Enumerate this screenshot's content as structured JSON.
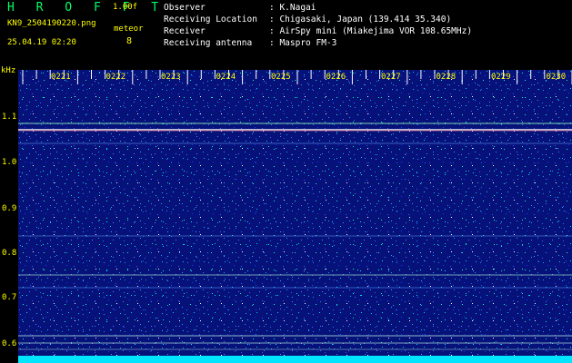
{
  "header": {
    "app_title": "H R O F F T",
    "version": "1.00f",
    "filename": "KN9_2504190220.png",
    "meteor_label": "meteor",
    "meteor_count": "8",
    "datetime": "25.04.19 02:20"
  },
  "info": [
    {
      "key": "Observer",
      "value": ": K.Nagai"
    },
    {
      "key": "Receiving Location",
      "value": ": Chigasaki, Japan (139.414 35.340)"
    },
    {
      "key": "Receiver",
      "value": ": AirSpy mini (Miakejima VOR 108.65MHz)"
    },
    {
      "key": "Receiving antenna",
      "value": ": Maspro FM-3"
    }
  ],
  "axis": {
    "unit": "kHz",
    "y_labels": [
      "1.1",
      "1.0",
      "0.9",
      "0.8",
      "0.7",
      "0.6"
    ],
    "time_labels": [
      "0221",
      "0222",
      "0223",
      "0224",
      "0225",
      "0226",
      "0227",
      "0228",
      "0229",
      "0230"
    ]
  },
  "colors": {
    "background": "#000000",
    "spectrogram_base": "#06127a",
    "label_yellow": "#ffff00",
    "title_green": "#00ff66",
    "bottom_band": "#00e5ff"
  }
}
